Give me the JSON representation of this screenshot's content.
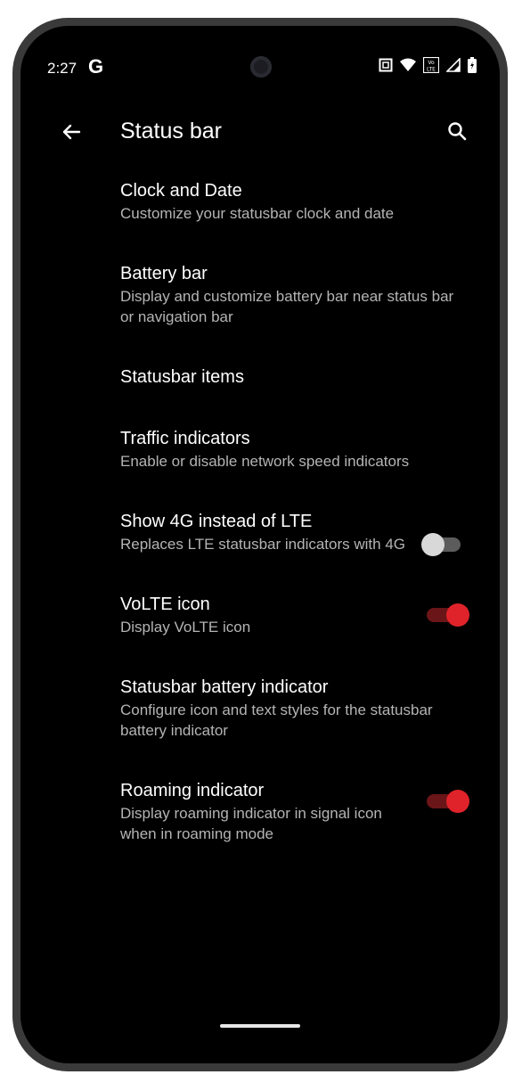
{
  "status_bar": {
    "time": "2:27",
    "google_glyph": "G",
    "icons": [
      "nfc-icon",
      "wifi-icon",
      "volte-icon",
      "signal-icon",
      "battery-icon"
    ]
  },
  "app_bar": {
    "title": "Status bar",
    "back_icon": "arrow-back-icon",
    "search_icon": "search-icon"
  },
  "settings": {
    "clock": {
      "title": "Clock and Date",
      "subtitle": "Customize your statusbar clock and date"
    },
    "battery_bar": {
      "title": "Battery bar",
      "subtitle": "Display and customize battery bar near status bar or navigation bar"
    },
    "statusbar_items": {
      "title": "Statusbar items"
    },
    "traffic": {
      "title": "Traffic indicators",
      "subtitle": "Enable or disable network speed indicators"
    },
    "show_4g": {
      "title": "Show 4G instead of LTE",
      "subtitle": "Replaces LTE statusbar indicators with 4G",
      "enabled": false
    },
    "volte": {
      "title": "VoLTE icon",
      "subtitle": "Display VoLTE icon",
      "enabled": true
    },
    "battery_indicator": {
      "title": "Statusbar battery indicator",
      "subtitle": "Configure icon and text styles for the statusbar battery indicator"
    },
    "roaming": {
      "title": "Roaming indicator",
      "subtitle": "Display roaming indicator in signal icon when in roaming mode",
      "enabled": true
    }
  },
  "colors": {
    "background": "#000000",
    "accent": "#e0232a",
    "switch_off_thumb": "#d8d8d8",
    "secondary_text": "#b4b4b4"
  }
}
